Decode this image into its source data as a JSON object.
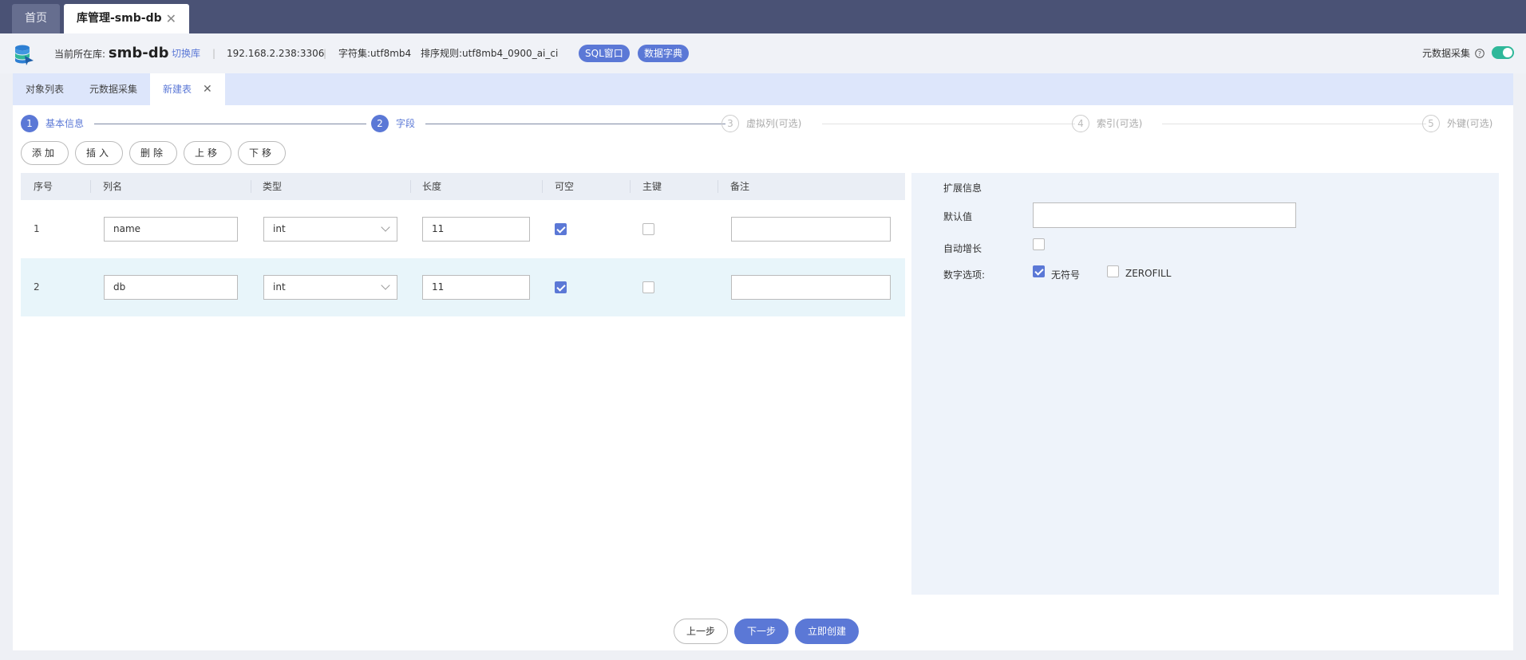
{
  "top_tabs": [
    {
      "label": "首页"
    },
    {
      "label": "库管理-smb-db",
      "close": "✕"
    }
  ],
  "infobar": {
    "current_db_label": "当前所在库:",
    "current_db_name": "smb-db",
    "switch_db": "切换库",
    "separator": "|",
    "host": "192.168.2.238:3306",
    "charset": "字符集:utf8mb4",
    "collation": "排序规则:utf8mb4_0900_ai_ci",
    "sql_window": "SQL窗口",
    "data_dict": "数据字典",
    "metadata_collect": "元数据采集",
    "help_glyph": "?",
    "metadata_toggle_on": true
  },
  "sub_tabs": [
    {
      "label": "对象列表"
    },
    {
      "label": "元数据采集"
    },
    {
      "label": "新建表",
      "close": "✕"
    }
  ],
  "steps": [
    {
      "num": "1",
      "label": "基本信息",
      "state": "done"
    },
    {
      "num": "2",
      "label": "字段",
      "state": "done"
    },
    {
      "num": "3",
      "label": "虚拟列(可选)",
      "state": "todo"
    },
    {
      "num": "4",
      "label": "索引(可选)",
      "state": "todo"
    },
    {
      "num": "5",
      "label": "外键(可选)",
      "state": "todo"
    }
  ],
  "toolbar": {
    "add": "添加",
    "insert": "插入",
    "delete": "删除",
    "move_up": "上移",
    "move_down": "下移"
  },
  "table": {
    "headers": [
      "序号",
      "列名",
      "类型",
      "长度",
      "可空",
      "主键",
      "备注"
    ],
    "rows": [
      {
        "index": "1",
        "name": "name",
        "type": "int",
        "length": "11",
        "nullable": true,
        "primary": false,
        "comment": ""
      },
      {
        "index": "2",
        "name": "db",
        "type": "int",
        "length": "11",
        "nullable": true,
        "primary": false,
        "comment": ""
      }
    ]
  },
  "ext_panel": {
    "title": "扩展信息",
    "default_label": "默认值",
    "default_value": "",
    "auto_inc_label": "自动增长",
    "auto_inc": false,
    "numeric_label": "数字选项:",
    "unsigned_label": "无符号",
    "unsigned": true,
    "zerofill_label": "ZEROFILL",
    "zerofill": false
  },
  "bottom": {
    "prev": "上一步",
    "next": "下一步",
    "create": "立即创建"
  },
  "colors": {
    "accent": "#5b78d6",
    "topbar": "#4a5275",
    "toggle_on": "#2fb89a"
  }
}
